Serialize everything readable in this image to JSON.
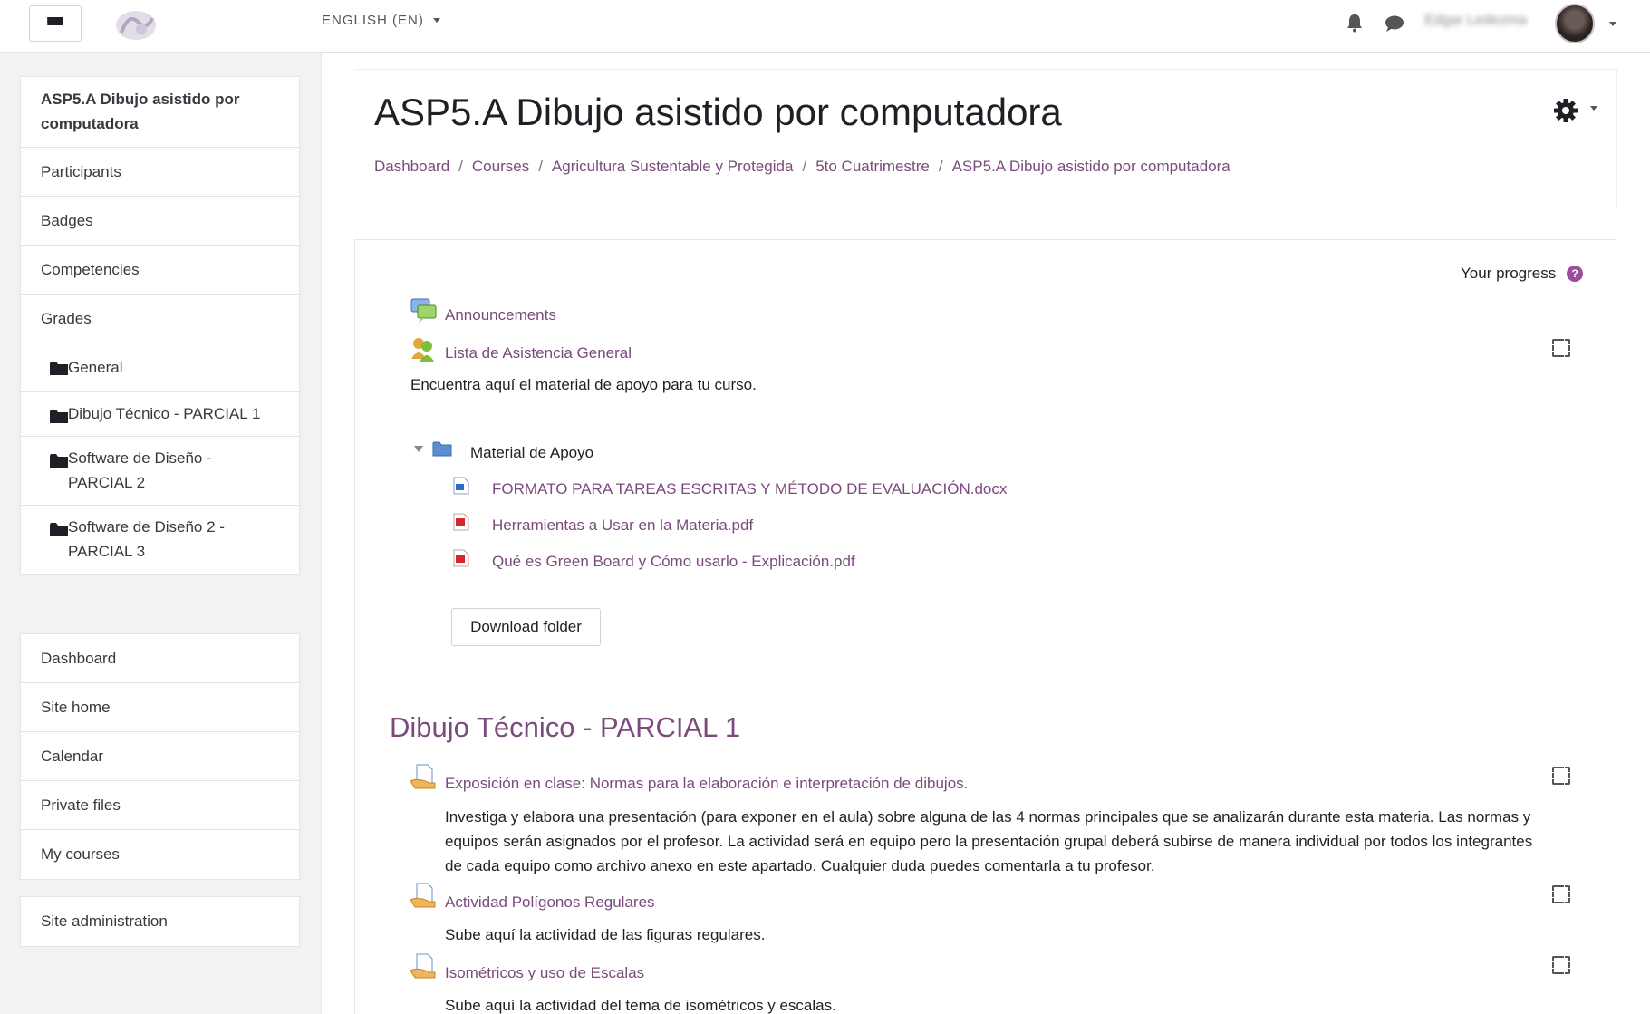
{
  "navbar": {
    "language": "ENGLISH (EN)",
    "username": "Edgar Ledezma"
  },
  "drawer": {
    "course_group": [
      {
        "label": "ASP5.A Dibujo asistido por computadora",
        "name": "drawer-course-home"
      },
      {
        "label": "Participants",
        "name": "drawer-participants"
      },
      {
        "label": "Badges",
        "name": "drawer-badges"
      },
      {
        "label": "Competencies",
        "name": "drawer-competencies"
      },
      {
        "label": "Grades",
        "name": "drawer-grades"
      },
      {
        "label": "General",
        "name": "drawer-section-general"
      },
      {
        "label": "Dibujo Técnico - PARCIAL 1",
        "name": "drawer-section-parcial-1"
      },
      {
        "label": "Software de Diseño - PARCIAL 2",
        "name": "drawer-section-parcial-2"
      },
      {
        "label": "Software de Diseño 2 - PARCIAL 3",
        "name": "drawer-section-parcial-3"
      }
    ],
    "site_group": [
      {
        "label": "Dashboard"
      },
      {
        "label": "Site home"
      },
      {
        "label": "Calendar"
      },
      {
        "label": "Private files"
      },
      {
        "label": "My courses"
      }
    ],
    "admin_group": [
      {
        "label": "Site administration"
      }
    ]
  },
  "header": {
    "title": "ASP5.A Dibujo asistido por computadora",
    "breadcrumb": [
      "Dashboard",
      "Courses",
      "Agricultura Sustentable y Protegida",
      "5to Cuatrimestre",
      "ASP5.A Dibujo asistido por computadora"
    ],
    "separator": "/"
  },
  "content": {
    "progress_label": "Your progress",
    "help_glyph": "?",
    "announcements": "Announcements",
    "attendance": "Lista de Asistencia General",
    "intro_text": "Encuentra aquí el material de apoyo para tu curso.",
    "folder_name": "Material de Apoyo",
    "files": [
      "FORMATO PARA TAREAS ESCRITAS Y MÉTODO DE EVALUACIÓN.docx",
      "Herramientas a Usar en la Materia.pdf",
      "Qué es Green Board y Cómo usarlo - Explicación.pdf"
    ],
    "download_button": "Download folder",
    "section_title": "Dibujo Técnico - PARCIAL 1",
    "activities": [
      {
        "title": "Exposición en clase: Normas para la elaboración e interpretación de dibujos.",
        "description": "Investiga y elabora una presentación (para exponer en el aula) sobre alguna de las 4 normas principales que se analizarán durante esta materia. Las normas y equipos serán asignados por el profesor. La actividad será en equipo pero la presentación grupal deberá subirse de manera individual por todos los integrantes de cada equipo como archivo anexo en este apartado. Cualquier duda puedes comentarla a tu profesor."
      },
      {
        "title": "Actividad Polígonos Regulares",
        "description": "Sube aquí la actividad de las figuras regulares."
      },
      {
        "title": "Isométricos y uso de Escalas",
        "description": "Sube aquí la actividad del tema de isométricos y escalas."
      }
    ]
  },
  "colors": {
    "link": "#7a4b7c",
    "drawer_bg": "#f2f2f2",
    "help_icon": "#9b4e9e"
  }
}
